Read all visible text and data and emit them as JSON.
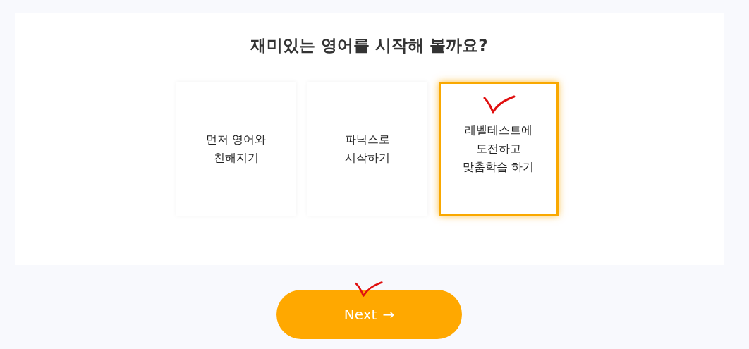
{
  "title": "재미있는 영어를 시작해 볼까요?",
  "options": [
    {
      "label": "먼저 영어와\n친해지기",
      "selected": false
    },
    {
      "label": "파닉스로\n시작하기",
      "selected": false
    },
    {
      "label": "레벨테스트에\n도전하고\n맞춤학습 하기",
      "selected": true
    }
  ],
  "next_button": {
    "label": "Next",
    "icon": "→"
  }
}
